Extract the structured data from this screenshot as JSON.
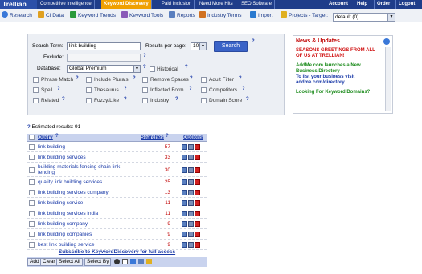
{
  "topbar": {
    "logo": "Trellian",
    "nav": [
      "Competitive Intelligence",
      "Keyword Discovery",
      "Paid Inclusion",
      "Need More Hits",
      "SEO Software"
    ],
    "active_nav": "Keyword Discovery",
    "links": [
      "Account",
      "Help",
      "Order",
      "Logout"
    ]
  },
  "toolbar": {
    "items": [
      "Research",
      "CI Data",
      "Keyword Trends",
      "Keyword Tools",
      "Reports",
      "Industry Terms",
      "Import",
      "Projects - Target:"
    ],
    "project_value": "default (0)"
  },
  "search": {
    "term_label": "Search Term:",
    "term_value": "link building",
    "results_label": "Results per page:",
    "results_value": "10",
    "button": "Search",
    "exclude_label": "Exclude:",
    "exclude_value": "",
    "database_label": "Database:",
    "database_value": "Global Premium",
    "historical_label": "Historical",
    "checkboxes": [
      "Phrase Match",
      "Include Plurals",
      "Remove Spaces",
      "Adult Filter",
      "Spell",
      "Thesaurus",
      "Inflected Form",
      "Competitors",
      "Related",
      "Fuzzy/Like",
      "Industry",
      "Domain Score"
    ],
    "help": "?"
  },
  "news": {
    "title": "News & Updates",
    "item1": "SEASONS GREETINGS FROM ALL OF US AT TRELLIAN!",
    "item2": "AddMe.com launches a New Business Directory",
    "item3": "To list your business visit addme.com/directory",
    "item4": "Looking For Keyword Domains?"
  },
  "results": {
    "estimated": "Estimated results: 91",
    "col_query": "Query",
    "col_searches": "Searches",
    "col_options": "Options",
    "rows": [
      {
        "query": "link building",
        "searches": "57"
      },
      {
        "query": "link building services",
        "searches": "33"
      },
      {
        "query": "building materials fencing chain link fencing",
        "searches": "30"
      },
      {
        "query": "quality link building services",
        "searches": "25"
      },
      {
        "query": "link building services company",
        "searches": "13"
      },
      {
        "query": "link building service",
        "searches": "11"
      },
      {
        "query": "link building services india",
        "searches": "11"
      },
      {
        "query": "link building company",
        "searches": "9"
      },
      {
        "query": "link building companies",
        "searches": "9"
      },
      {
        "query": "best link building service",
        "searches": "9"
      }
    ],
    "subscribe": "Subscribe to KeywordDiscovery for full access",
    "buttons": [
      "Add",
      "Clear",
      "Select All",
      "Select By"
    ]
  }
}
